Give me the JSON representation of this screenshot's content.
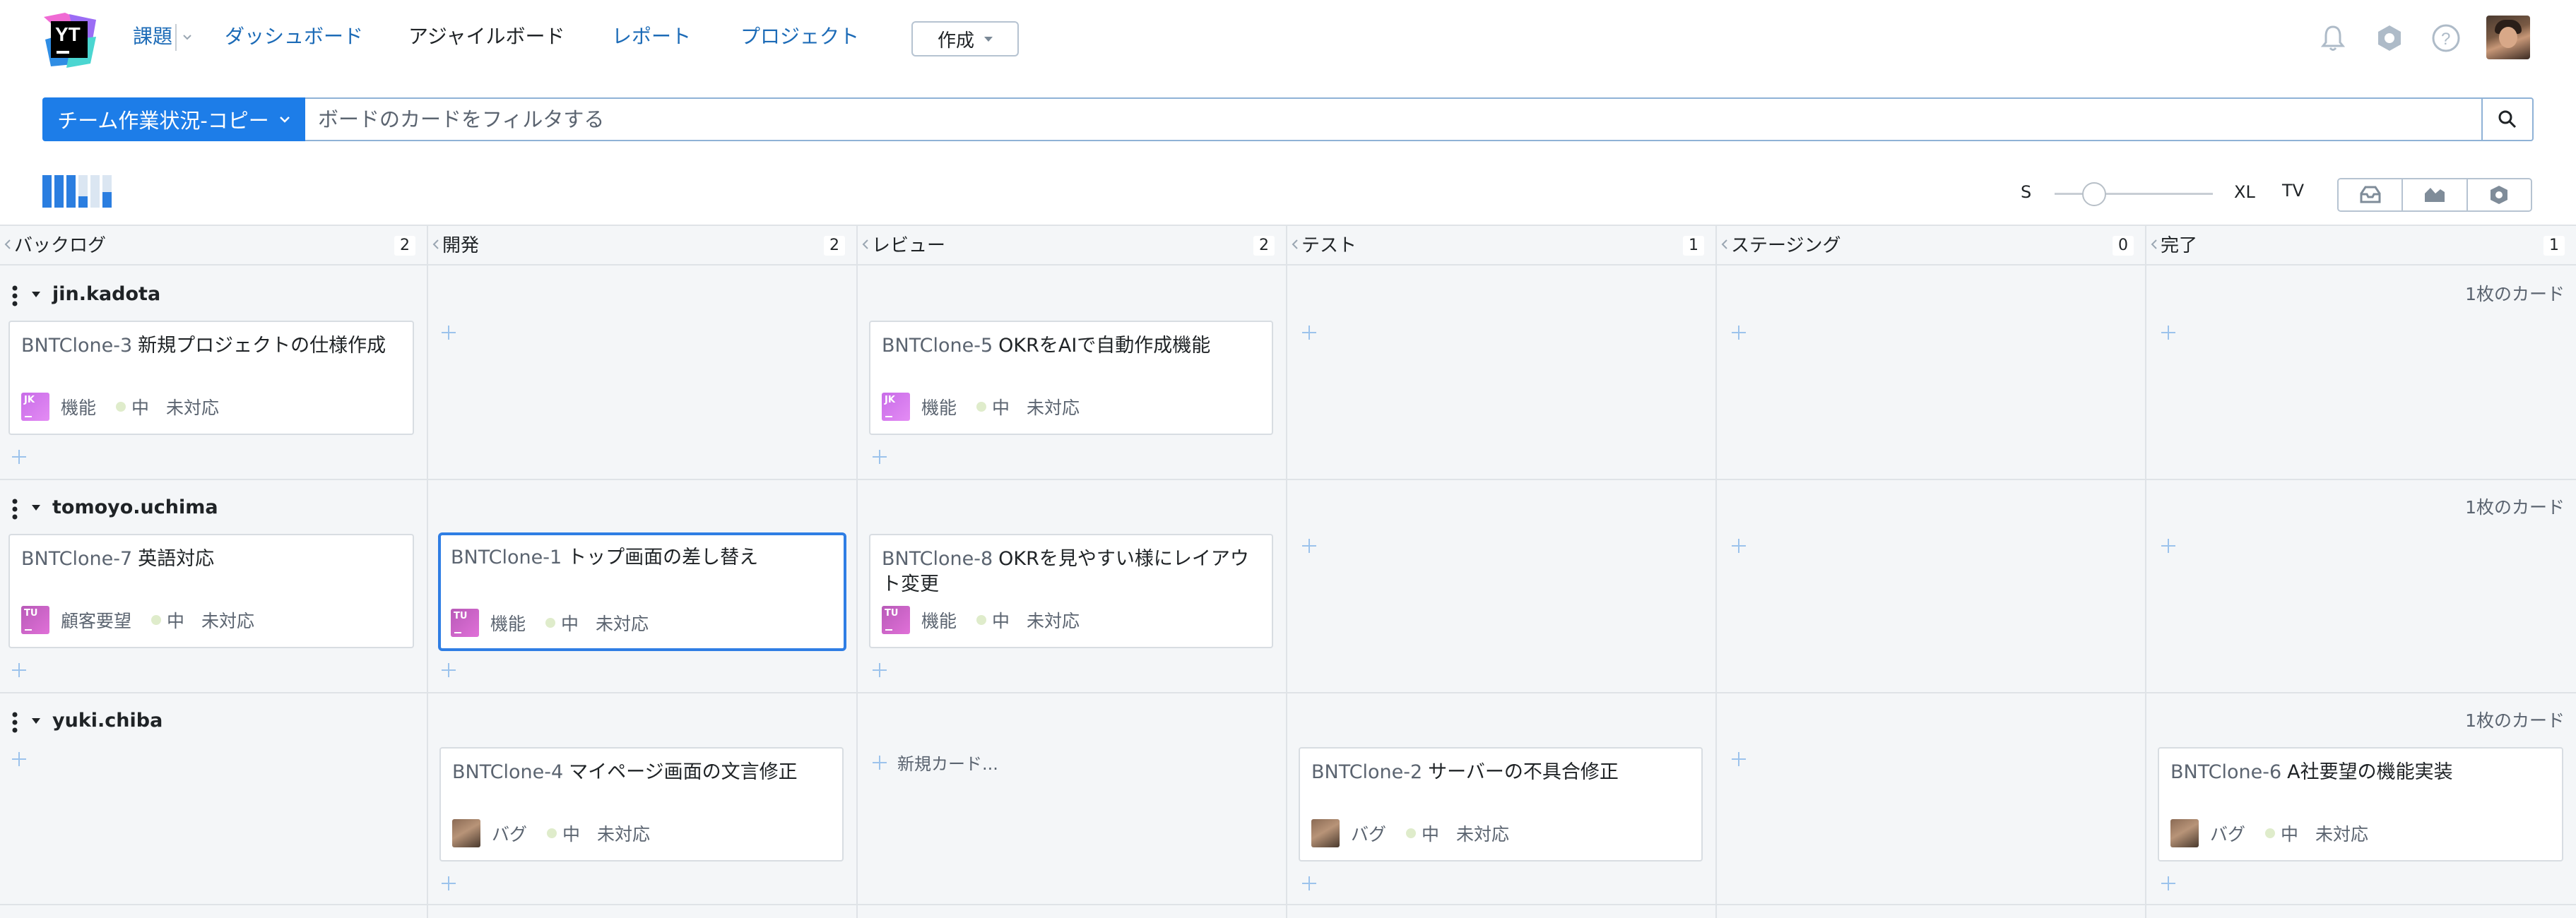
{
  "header": {
    "logo_text": "YT",
    "nav": {
      "issues": "課題",
      "dashboards": "ダッシュボード",
      "agile_boards": "アジャイルボード",
      "reports": "レポート",
      "projects": "プロジェクト"
    },
    "create_label": "作成",
    "icons": [
      "bell-icon",
      "settings-icon",
      "help-icon"
    ],
    "accent_color": "#1d7de8"
  },
  "filter": {
    "query_label": "チーム作業状況-コピー",
    "search_placeholder": "ボードのカードをフィルタする",
    "search_value": ""
  },
  "toolbar": {
    "size_min": "S",
    "size_max": "XL",
    "tv_label": "TV",
    "card_size_level": 0.25,
    "tools": [
      "backlog-icon",
      "chart-icon",
      "settings-icon"
    ]
  },
  "columns": [
    {
      "name": "バックログ",
      "count": "2"
    },
    {
      "name": "開発",
      "count": "2"
    },
    {
      "name": "レビュー",
      "count": "2"
    },
    {
      "name": "テスト",
      "count": "1"
    },
    {
      "name": "ステージング",
      "count": "0"
    },
    {
      "name": "完了",
      "count": "1"
    }
  ],
  "swimlanes": [
    {
      "name": "jin.kadota",
      "count": "1枚のカード"
    },
    {
      "name": "tomoyo.uchima",
      "count": "1枚のカード"
    },
    {
      "name": "yuki.chiba",
      "count": "1枚のカード"
    }
  ],
  "cards": [
    {
      "id": "BNTClone-3",
      "title": "新規プロジェクトの仕様作成",
      "avatar": "JK",
      "type": "機能",
      "priority": "中",
      "state": "未対応"
    },
    {
      "id": "BNTClone-5",
      "title": "OKRをAIで自動作成機能",
      "avatar": "JK",
      "type": "機能",
      "priority": "中",
      "state": "未対応"
    },
    {
      "id": "BNTClone-7",
      "title": "英語対応",
      "avatar": "TU",
      "type": "顧客要望",
      "priority": "中",
      "state": "未対応"
    },
    {
      "id": "BNTClone-1",
      "title": "トップ画面の差し替え",
      "avatar": "TU",
      "type": "機能",
      "priority": "中",
      "state": "未対応"
    },
    {
      "id": "BNTClone-8",
      "title": "OKRを見やすい様にレイアウト変更",
      "avatar": "TU",
      "type": "機能",
      "priority": "中",
      "state": "未対応"
    },
    {
      "id": "BNTClone-4",
      "title": "マイページ画面の文言修正",
      "avatar": "",
      "type": "バグ",
      "priority": "中",
      "state": "未対応"
    },
    {
      "id": "BNTClone-2",
      "title": "サーバーの不具合修正",
      "avatar": "",
      "type": "バグ",
      "priority": "中",
      "state": "未対応"
    },
    {
      "id": "BNTClone-6",
      "title": "A社要望の機能実装",
      "avatar": "",
      "type": "バグ",
      "priority": "中",
      "state": "未対応"
    }
  ],
  "new_card_label": "新規カード..."
}
